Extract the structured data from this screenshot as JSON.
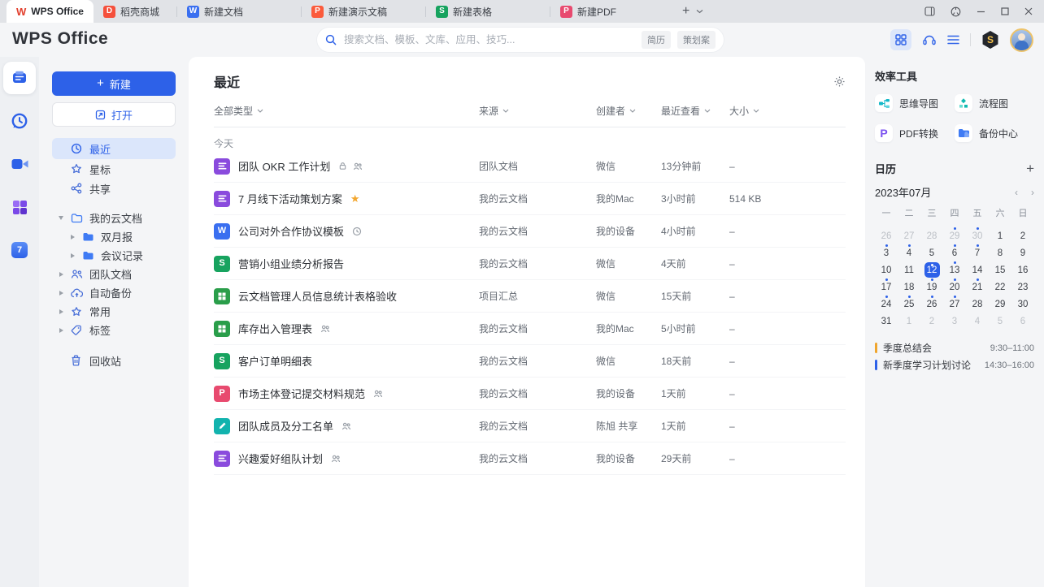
{
  "colors": {
    "accent": "#2d61e8",
    "star": "#f3a72f",
    "event_gold": "#efa52d",
    "event_blue": "#2d61e8"
  },
  "window": {
    "tabs": [
      {
        "label": "WPS Office"
      },
      {
        "label": "稻壳商城"
      },
      {
        "label": "新建文档"
      },
      {
        "label": "新建演示文稿"
      },
      {
        "label": "新建表格"
      },
      {
        "label": "新建PDF"
      }
    ]
  },
  "header": {
    "logo": "WPS Office",
    "search_placeholder": "搜索文档、模板、文库、应用、技巧...",
    "search_tags": [
      "简历",
      "策划案"
    ]
  },
  "sidebar": {
    "new_button": "新建",
    "open_button": "打开",
    "menu": [
      {
        "label": "最近"
      },
      {
        "label": "星标"
      },
      {
        "label": "共享"
      }
    ],
    "tree": [
      {
        "label": "我的云文档"
      },
      {
        "label": "双月报"
      },
      {
        "label": "会议记录"
      },
      {
        "label": "团队文档"
      },
      {
        "label": "自动备份"
      },
      {
        "label": "常用"
      },
      {
        "label": "标签"
      }
    ],
    "trash": "回收站"
  },
  "main": {
    "title": "最近",
    "filters": [
      "全部类型",
      "来源",
      "创建者",
      "最近查看",
      "大小"
    ],
    "group_label": "今天",
    "rows": [
      {
        "name": "团队 OKR 工作计划",
        "icon": "doc",
        "badges": [
          "lock",
          "members"
        ],
        "source": "团队文档",
        "creator": "微信",
        "viewed": "13分钟前",
        "size": "–"
      },
      {
        "name": "7 月线下活动策划方案",
        "icon": "doc",
        "badges": [
          "star"
        ],
        "source": "我的云文档",
        "creator": "我的Mac",
        "viewed": "3小时前",
        "size": "514 KB"
      },
      {
        "name": "公司对外合作协议模板",
        "icon": "word",
        "badges": [
          "history"
        ],
        "source": "我的云文档",
        "creator": "我的设备",
        "viewed": "4小时前",
        "size": "–"
      },
      {
        "name": "营销小组业绩分析报告",
        "icon": "sheet",
        "badges": [],
        "source": "我的云文档",
        "creator": "微信",
        "viewed": "4天前",
        "size": "–"
      },
      {
        "name": "云文档管理人员信息统计表格验收",
        "icon": "grid",
        "badges": [],
        "source": "项目汇总",
        "creator": "微信",
        "viewed": "15天前",
        "size": "–"
      },
      {
        "name": "库存出入管理表",
        "icon": "grid",
        "badges": [
          "members"
        ],
        "source": "我的云文档",
        "creator": "我的Mac",
        "viewed": "5小时前",
        "size": "–"
      },
      {
        "name": "客户订单明细表",
        "icon": "sheet",
        "badges": [],
        "source": "我的云文档",
        "creator": "微信",
        "viewed": "18天前",
        "size": "–"
      },
      {
        "name": "市场主体登记提交材料规范",
        "icon": "pdf",
        "badges": [
          "members"
        ],
        "source": "我的云文档",
        "creator": "我的设备",
        "viewed": "1天前",
        "size": "–"
      },
      {
        "name": "团队成员及分工名单",
        "icon": "form",
        "badges": [
          "members"
        ],
        "source": "我的云文档",
        "creator": "陈旭 共享",
        "viewed": "1天前",
        "size": "–"
      },
      {
        "name": "兴趣爱好组队计划",
        "icon": "doc",
        "badges": [
          "members"
        ],
        "source": "我的云文档",
        "creator": "我的设备",
        "viewed": "29天前",
        "size": "–"
      }
    ]
  },
  "panel": {
    "tools_title": "效率工具",
    "tools": [
      {
        "label": "思维导图"
      },
      {
        "label": "流程图"
      },
      {
        "label": "PDF转换"
      },
      {
        "label": "备份中心"
      }
    ],
    "calendar": {
      "title": "日历",
      "month": "2023年07月",
      "weekdays": [
        "一",
        "二",
        "三",
        "四",
        "五",
        "六",
        "日"
      ],
      "weeks": [
        [
          {
            "d": "26",
            "muted": true
          },
          {
            "d": "27",
            "muted": true
          },
          {
            "d": "28",
            "muted": true
          },
          {
            "d": "29",
            "muted": true,
            "dot": true
          },
          {
            "d": "30",
            "muted": true,
            "dot": true
          },
          {
            "d": "1"
          },
          {
            "d": "2"
          }
        ],
        [
          {
            "d": "3",
            "dot": true
          },
          {
            "d": "4",
            "dot": true
          },
          {
            "d": "5"
          },
          {
            "d": "6",
            "dot": true
          },
          {
            "d": "7",
            "dot": true
          },
          {
            "d": "8"
          },
          {
            "d": "9"
          }
        ],
        [
          {
            "d": "10"
          },
          {
            "d": "11"
          },
          {
            "d": "12",
            "selected": true,
            "dot": true
          },
          {
            "d": "13",
            "dot": true
          },
          {
            "d": "14"
          },
          {
            "d": "15"
          },
          {
            "d": "16"
          }
        ],
        [
          {
            "d": "17",
            "dot": true
          },
          {
            "d": "18"
          },
          {
            "d": "19",
            "dot": true
          },
          {
            "d": "20",
            "dot": true
          },
          {
            "d": "21",
            "dot": true
          },
          {
            "d": "22"
          },
          {
            "d": "23"
          }
        ],
        [
          {
            "d": "24",
            "dot": true
          },
          {
            "d": "25",
            "dot": true
          },
          {
            "d": "26",
            "dot": true
          },
          {
            "d": "27",
            "dot": true
          },
          {
            "d": "28"
          },
          {
            "d": "29"
          },
          {
            "d": "30"
          }
        ],
        [
          {
            "d": "31"
          },
          {
            "d": "1",
            "muted": true
          },
          {
            "d": "2",
            "muted": true
          },
          {
            "d": "3",
            "muted": true
          },
          {
            "d": "4",
            "muted": true
          },
          {
            "d": "5",
            "muted": true
          },
          {
            "d": "6",
            "muted": true
          }
        ]
      ]
    },
    "events": [
      {
        "label": "季度总结会",
        "time": "9:30–11:00",
        "color": "#efa52d"
      },
      {
        "label": "新季度学习计划讨论",
        "time": "14:30–16:00",
        "color": "#2d61e8"
      }
    ]
  }
}
